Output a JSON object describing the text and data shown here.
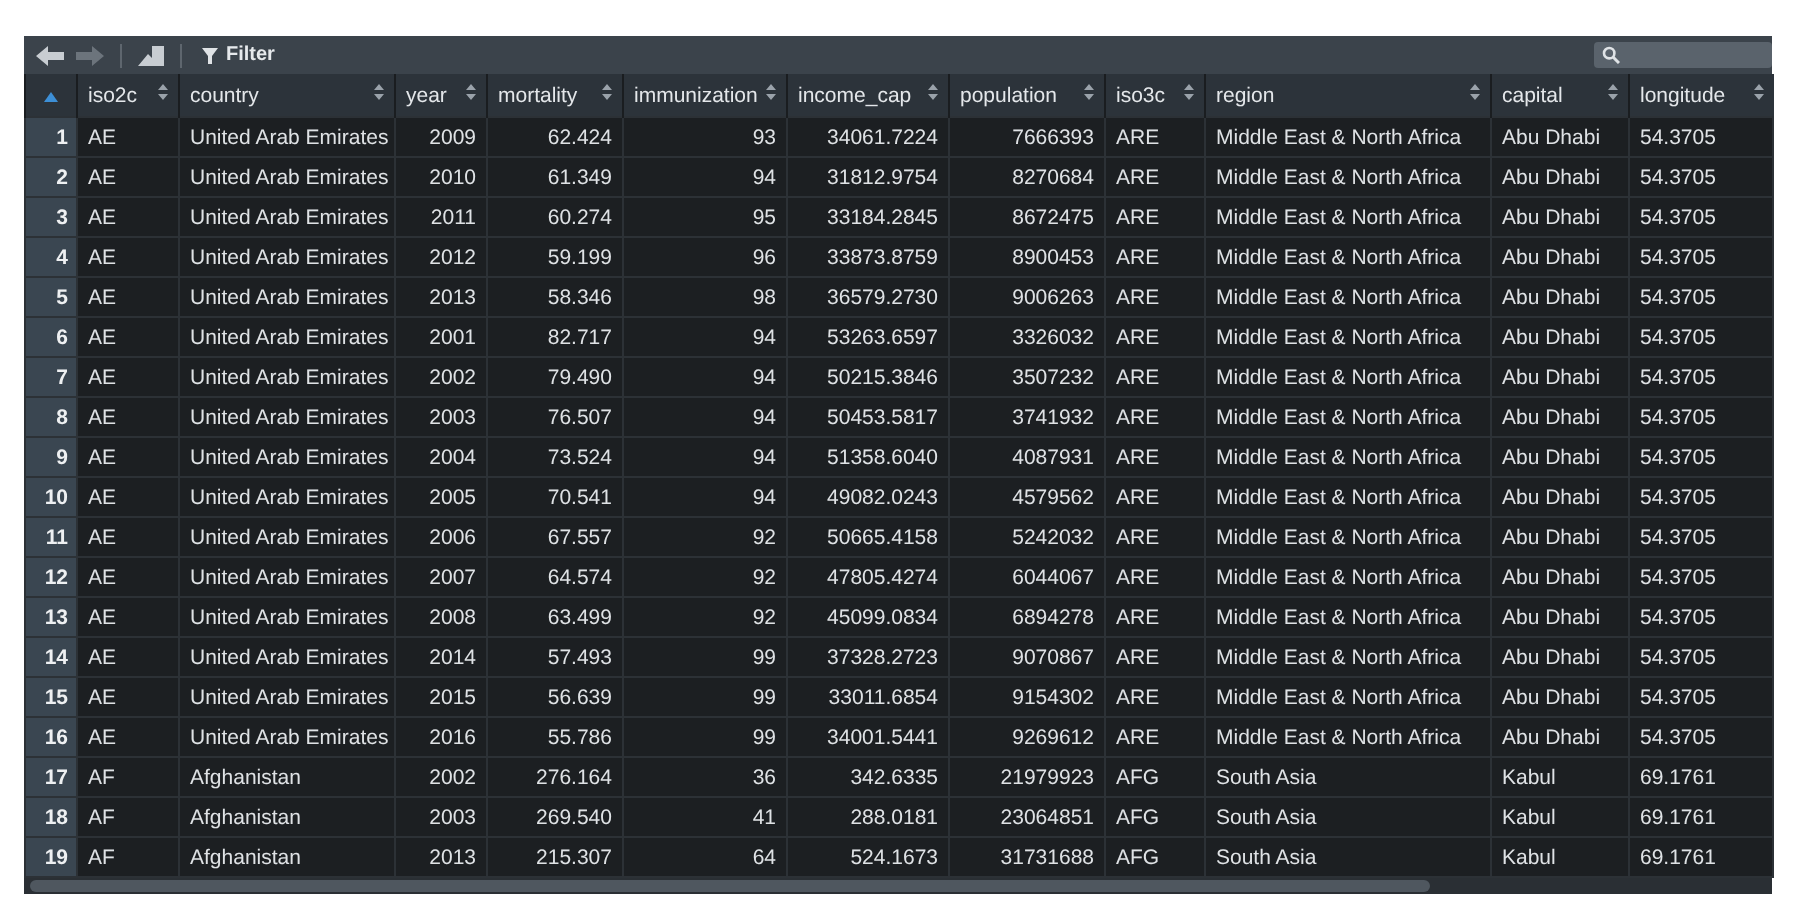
{
  "toolbar": {
    "filter_label": "Filter"
  },
  "table": {
    "columns": [
      {
        "label": "iso2c",
        "kind": "text"
      },
      {
        "label": "country",
        "kind": "text"
      },
      {
        "label": "year",
        "kind": "number"
      },
      {
        "label": "mortality",
        "kind": "number"
      },
      {
        "label": "immunization",
        "kind": "number"
      },
      {
        "label": "income_cap",
        "kind": "number"
      },
      {
        "label": "population",
        "kind": "number"
      },
      {
        "label": "iso3c",
        "kind": "text"
      },
      {
        "label": "region",
        "kind": "text"
      },
      {
        "label": "capital",
        "kind": "text"
      },
      {
        "label": "longitude",
        "kind": "text"
      }
    ],
    "rows": [
      {
        "number": "1",
        "cells": [
          "AE",
          "United Arab Emirates",
          "2009",
          "62.424",
          "93",
          "34061.7224",
          "7666393",
          "ARE",
          "Middle East & North Africa",
          "Abu Dhabi",
          "54.3705"
        ]
      },
      {
        "number": "2",
        "cells": [
          "AE",
          "United Arab Emirates",
          "2010",
          "61.349",
          "94",
          "31812.9754",
          "8270684",
          "ARE",
          "Middle East & North Africa",
          "Abu Dhabi",
          "54.3705"
        ]
      },
      {
        "number": "3",
        "cells": [
          "AE",
          "United Arab Emirates",
          "2011",
          "60.274",
          "95",
          "33184.2845",
          "8672475",
          "ARE",
          "Middle East & North Africa",
          "Abu Dhabi",
          "54.3705"
        ]
      },
      {
        "number": "4",
        "cells": [
          "AE",
          "United Arab Emirates",
          "2012",
          "59.199",
          "96",
          "33873.8759",
          "8900453",
          "ARE",
          "Middle East & North Africa",
          "Abu Dhabi",
          "54.3705"
        ]
      },
      {
        "number": "5",
        "cells": [
          "AE",
          "United Arab Emirates",
          "2013",
          "58.346",
          "98",
          "36579.2730",
          "9006263",
          "ARE",
          "Middle East & North Africa",
          "Abu Dhabi",
          "54.3705"
        ]
      },
      {
        "number": "6",
        "cells": [
          "AE",
          "United Arab Emirates",
          "2001",
          "82.717",
          "94",
          "53263.6597",
          "3326032",
          "ARE",
          "Middle East & North Africa",
          "Abu Dhabi",
          "54.3705"
        ]
      },
      {
        "number": "7",
        "cells": [
          "AE",
          "United Arab Emirates",
          "2002",
          "79.490",
          "94",
          "50215.3846",
          "3507232",
          "ARE",
          "Middle East & North Africa",
          "Abu Dhabi",
          "54.3705"
        ]
      },
      {
        "number": "8",
        "cells": [
          "AE",
          "United Arab Emirates",
          "2003",
          "76.507",
          "94",
          "50453.5817",
          "3741932",
          "ARE",
          "Middle East & North Africa",
          "Abu Dhabi",
          "54.3705"
        ]
      },
      {
        "number": "9",
        "cells": [
          "AE",
          "United Arab Emirates",
          "2004",
          "73.524",
          "94",
          "51358.6040",
          "4087931",
          "ARE",
          "Middle East & North Africa",
          "Abu Dhabi",
          "54.3705"
        ]
      },
      {
        "number": "10",
        "cells": [
          "AE",
          "United Arab Emirates",
          "2005",
          "70.541",
          "94",
          "49082.0243",
          "4579562",
          "ARE",
          "Middle East & North Africa",
          "Abu Dhabi",
          "54.3705"
        ]
      },
      {
        "number": "11",
        "cells": [
          "AE",
          "United Arab Emirates",
          "2006",
          "67.557",
          "92",
          "50665.4158",
          "5242032",
          "ARE",
          "Middle East & North Africa",
          "Abu Dhabi",
          "54.3705"
        ]
      },
      {
        "number": "12",
        "cells": [
          "AE",
          "United Arab Emirates",
          "2007",
          "64.574",
          "92",
          "47805.4274",
          "6044067",
          "ARE",
          "Middle East & North Africa",
          "Abu Dhabi",
          "54.3705"
        ]
      },
      {
        "number": "13",
        "cells": [
          "AE",
          "United Arab Emirates",
          "2008",
          "63.499",
          "92",
          "45099.0834",
          "6894278",
          "ARE",
          "Middle East & North Africa",
          "Abu Dhabi",
          "54.3705"
        ]
      },
      {
        "number": "14",
        "cells": [
          "AE",
          "United Arab Emirates",
          "2014",
          "57.493",
          "99",
          "37328.2723",
          "9070867",
          "ARE",
          "Middle East & North Africa",
          "Abu Dhabi",
          "54.3705"
        ]
      },
      {
        "number": "15",
        "cells": [
          "AE",
          "United Arab Emirates",
          "2015",
          "56.639",
          "99",
          "33011.6854",
          "9154302",
          "ARE",
          "Middle East & North Africa",
          "Abu Dhabi",
          "54.3705"
        ]
      },
      {
        "number": "16",
        "cells": [
          "AE",
          "United Arab Emirates",
          "2016",
          "55.786",
          "99",
          "34001.5441",
          "9269612",
          "ARE",
          "Middle East & North Africa",
          "Abu Dhabi",
          "54.3705"
        ]
      },
      {
        "number": "17",
        "cells": [
          "AF",
          "Afghanistan",
          "2002",
          "276.164",
          "36",
          "342.6335",
          "21979923",
          "AFG",
          "South Asia",
          "Kabul",
          "69.1761"
        ]
      },
      {
        "number": "18",
        "cells": [
          "AF",
          "Afghanistan",
          "2003",
          "269.540",
          "41",
          "288.0181",
          "23064851",
          "AFG",
          "South Asia",
          "Kabul",
          "69.1761"
        ]
      },
      {
        "number": "19",
        "cells": [
          "AF",
          "Afghanistan",
          "2013",
          "215.307",
          "64",
          "524.1673",
          "31731688",
          "AFG",
          "South Asia",
          "Kabul",
          "69.1761"
        ]
      }
    ]
  }
}
